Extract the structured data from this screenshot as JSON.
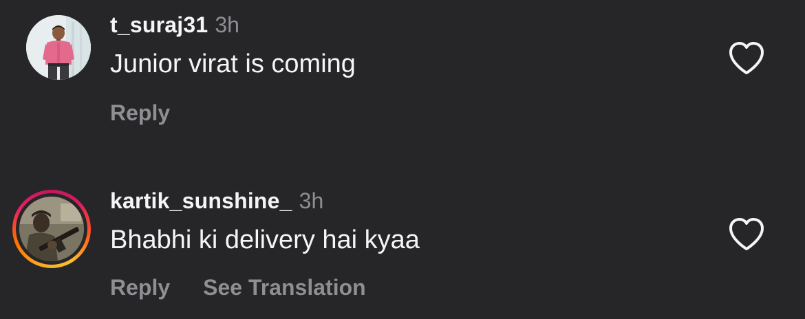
{
  "comments": [
    {
      "username": "t_suraj31",
      "time": "3h",
      "text": "Junior virat is coming",
      "actions": [
        "Reply"
      ],
      "avatar": "avatar-man-pink-shirt-icon"
    },
    {
      "username": "kartik_sunshine_",
      "time": "3h",
      "text": "Bhabhi ki delivery hai kyaa",
      "actions": [
        "Reply",
        "See Translation"
      ],
      "avatar": "avatar-soldier-icon",
      "has_story": true
    }
  ],
  "colors": {
    "background": "#262628",
    "primary_text": "#f5f5f5",
    "secondary_text": "#8e8e93",
    "story_ring": [
      "#fbc02d",
      "#ff6f00",
      "#e91e63"
    ]
  },
  "icons": {
    "like": "heart-outline-icon"
  }
}
